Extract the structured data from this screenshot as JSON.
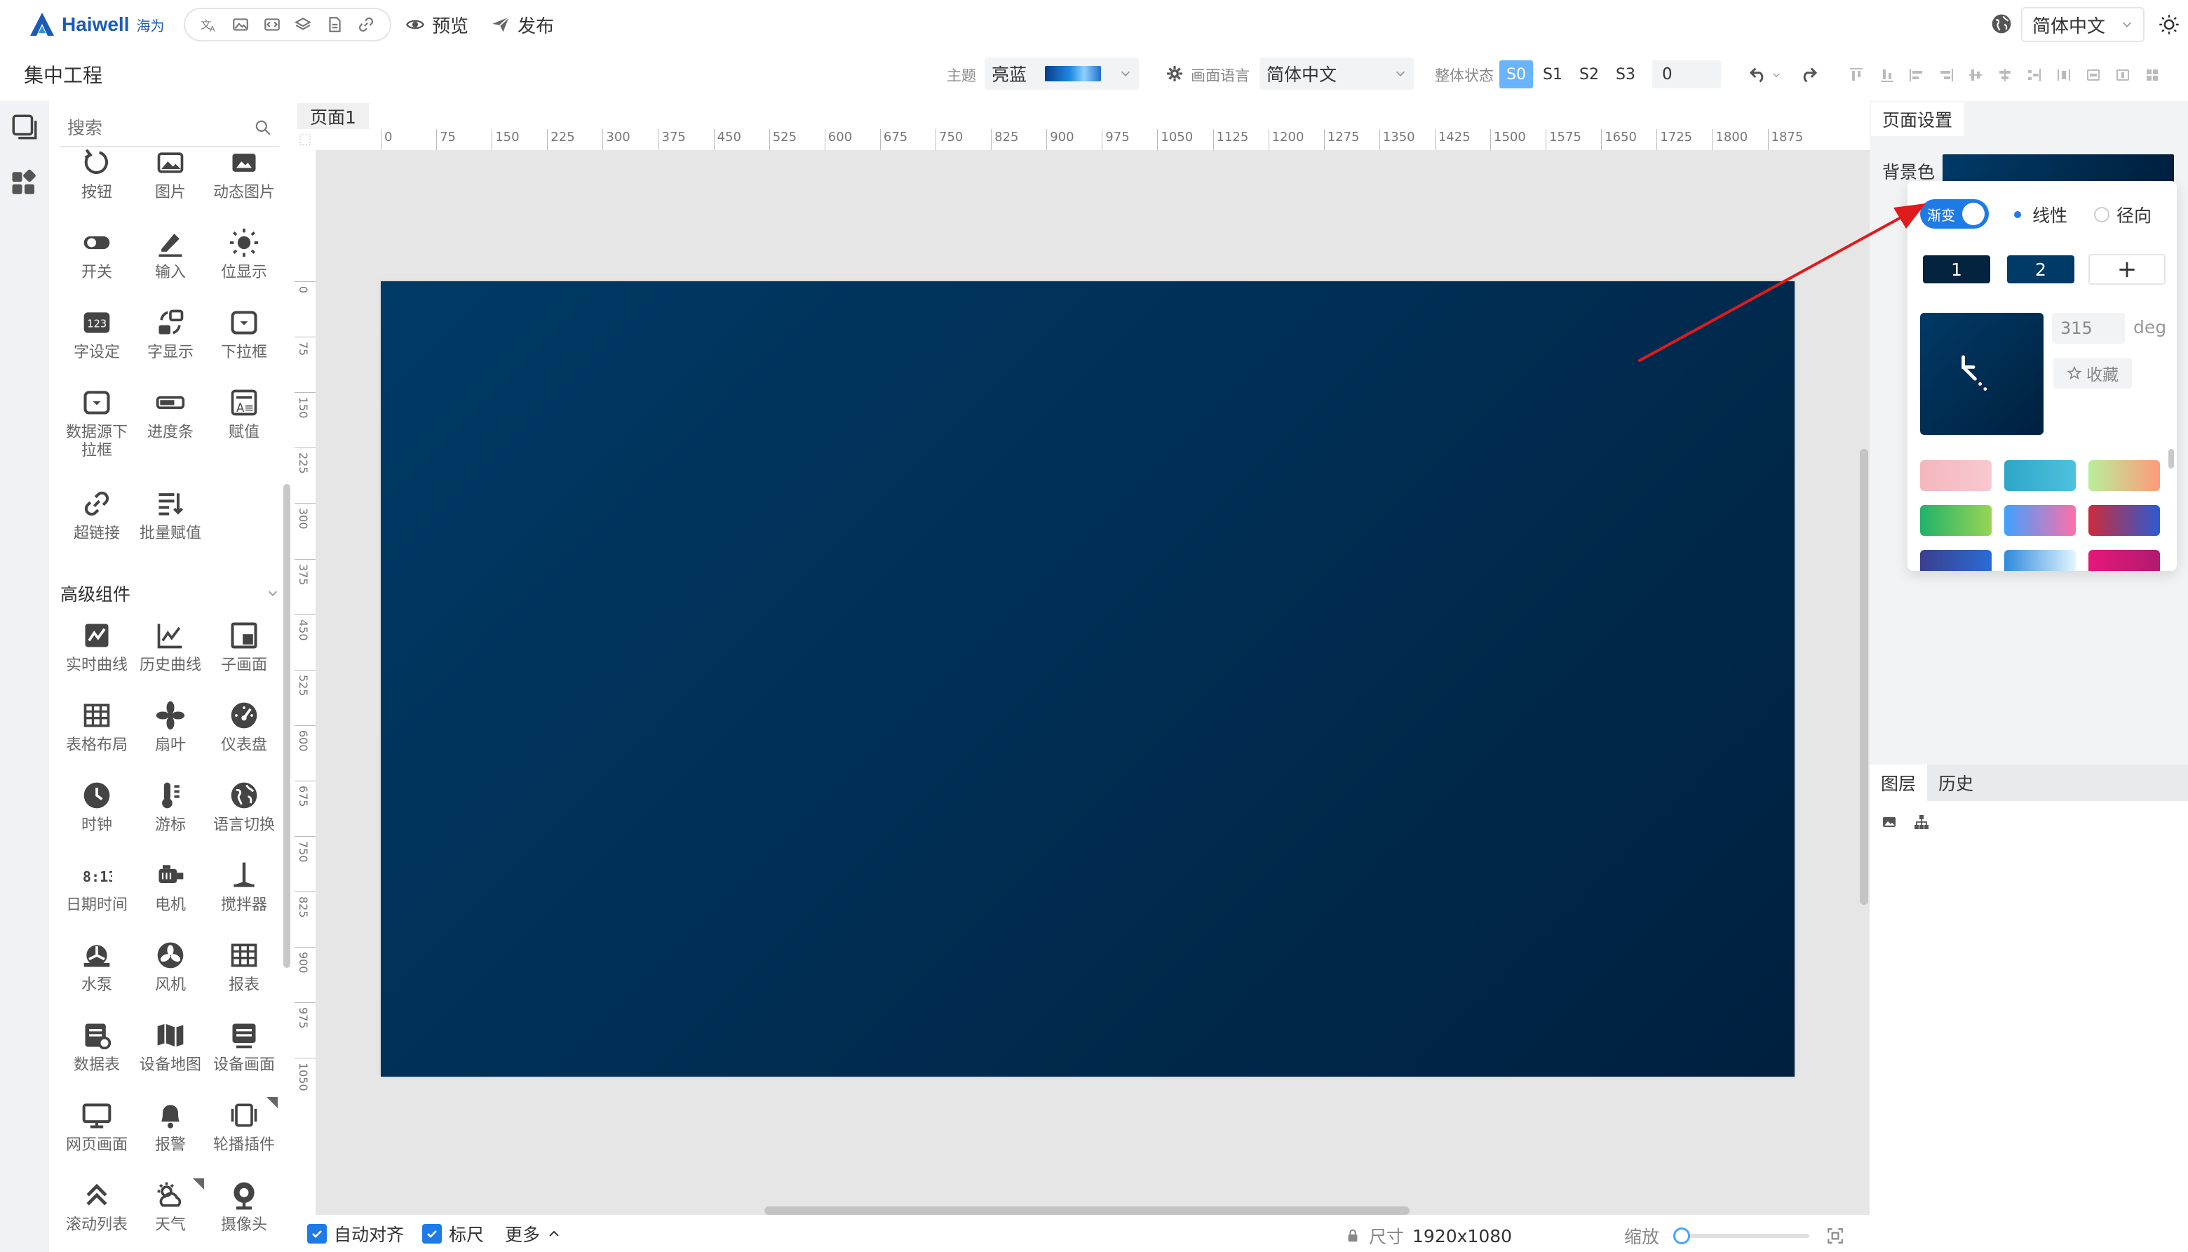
{
  "app": {
    "brand": "Haiwell",
    "brand_cn": "海为",
    "preview_label": "预览",
    "publish_label": "发布",
    "language_top": "简体中文",
    "quick_tools": [
      "translate-icon",
      "image-icon",
      "code-icon",
      "layers-icon",
      "document-icon",
      "link-icon"
    ]
  },
  "project": {
    "title": "集中工程",
    "theme_label": "主题",
    "theme_value": "亮蓝",
    "screen_lang_label": "画面语言",
    "screen_lang_value": "简体中文",
    "state_label": "整体状态",
    "states": [
      "S0",
      "S1",
      "S2",
      "S3"
    ],
    "active_state": "S0",
    "state_input": "0"
  },
  "components": {
    "search_placeholder": "搜索",
    "basic": [
      {
        "label": "按钮",
        "icon": "button-icon"
      },
      {
        "label": "图片",
        "icon": "picture-icon"
      },
      {
        "label": "动态图片",
        "icon": "dynamic-picture-icon"
      },
      {
        "label": "开关",
        "icon": "toggle-icon"
      },
      {
        "label": "输入",
        "icon": "pen-icon"
      },
      {
        "label": "位显示",
        "icon": "bulb-icon"
      },
      {
        "label": "字设定",
        "icon": "word-set-icon"
      },
      {
        "label": "字显示",
        "icon": "word-display-icon"
      },
      {
        "label": "下拉框",
        "icon": "dropdown-icon"
      },
      {
        "label": "数据源下拉框",
        "icon": "datasource-dropdown-icon"
      },
      {
        "label": "进度条",
        "icon": "progress-icon"
      },
      {
        "label": "赋值",
        "icon": "assign-icon"
      },
      {
        "label": "超链接",
        "icon": "hyperlink-icon"
      },
      {
        "label": "批量赋值",
        "icon": "batch-assign-icon"
      }
    ],
    "advanced_title": "高级组件",
    "advanced": [
      {
        "label": "实时曲线",
        "icon": "realtime-curve-icon"
      },
      {
        "label": "历史曲线",
        "icon": "history-curve-icon"
      },
      {
        "label": "子画面",
        "icon": "subscreen-icon"
      },
      {
        "label": "表格布局",
        "icon": "table-layout-icon"
      },
      {
        "label": "扇叶",
        "icon": "fan-blade-icon"
      },
      {
        "label": "仪表盘",
        "icon": "gauge-icon"
      },
      {
        "label": "时钟",
        "icon": "clock-icon"
      },
      {
        "label": "游标",
        "icon": "thermometer-icon"
      },
      {
        "label": "语言切换",
        "icon": "globe-icon"
      },
      {
        "label": "日期时间",
        "icon": "datetime-icon"
      },
      {
        "label": "电机",
        "icon": "motor-icon"
      },
      {
        "label": "搅拌器",
        "icon": "mixer-icon"
      },
      {
        "label": "水泵",
        "icon": "pump-icon"
      },
      {
        "label": "风机",
        "icon": "blower-icon"
      },
      {
        "label": "报表",
        "icon": "report-icon"
      },
      {
        "label": "数据表",
        "icon": "datatable-icon"
      },
      {
        "label": "设备地图",
        "icon": "device-map-icon"
      },
      {
        "label": "设备画面",
        "icon": "device-screen-icon"
      },
      {
        "label": "网页画面",
        "icon": "webpage-icon"
      },
      {
        "label": "报警",
        "icon": "alarm-bell-icon"
      },
      {
        "label": "轮播插件",
        "icon": "carousel-icon"
      },
      {
        "label": "滚动列表",
        "icon": "scroll-list-icon"
      },
      {
        "label": "天气",
        "icon": "weather-icon"
      },
      {
        "label": "摄像头",
        "icon": "camera-icon"
      }
    ]
  },
  "canvas": {
    "page_tab": "页面1",
    "h_ruler": [
      "0",
      "75",
      "150",
      "225",
      "300",
      "375",
      "450",
      "525",
      "600",
      "675",
      "750",
      "825",
      "900",
      "975",
      "1050",
      "1125",
      "1200",
      "1275",
      "1350",
      "1425",
      "1500",
      "1575",
      "1650",
      "1725",
      "1800",
      "1875"
    ],
    "v_ruler": [
      "0",
      "75",
      "150",
      "225",
      "300",
      "375",
      "450",
      "525",
      "600",
      "675",
      "750",
      "825",
      "900",
      "975",
      "1050"
    ],
    "bg_start": "#003a66",
    "bg_end": "#00203f"
  },
  "bottom": {
    "auto_align": "自动对齐",
    "ruler": "标尺",
    "more": "更多",
    "size_label": "尺寸",
    "size_value": "1920x1080",
    "zoom_label": "缩放"
  },
  "right": {
    "tab": "页面设置",
    "bg_label": "背景色",
    "gradient_toggle": "渐变",
    "linear": "线性",
    "radial": "径向",
    "stops": [
      "1",
      "2"
    ],
    "stop_colors": [
      "#04233f",
      "#003a66"
    ],
    "add_stop": "+",
    "angle": "315",
    "angle_unit": "deg",
    "favorite": "收藏",
    "presets": [
      [
        "#f4b6bd",
        "#f8c9cf"
      ],
      [
        "#2ea6c8",
        "#4cc2dd"
      ],
      [
        "#b7ef9a",
        "#ff9a7a"
      ],
      [
        "#21b26a",
        "#97d553"
      ],
      [
        "#3fa1ff",
        "#ff6fa8"
      ],
      [
        "#cc2b3b",
        "#2c5bd1"
      ],
      [
        "#3a3f8f",
        "#2b6cd4"
      ],
      [
        "#2d8bdc",
        "#e2f5ff"
      ],
      [
        "#e6177a",
        "#b01b6f"
      ]
    ],
    "layer_tab": "图层",
    "history_tab": "历史"
  }
}
